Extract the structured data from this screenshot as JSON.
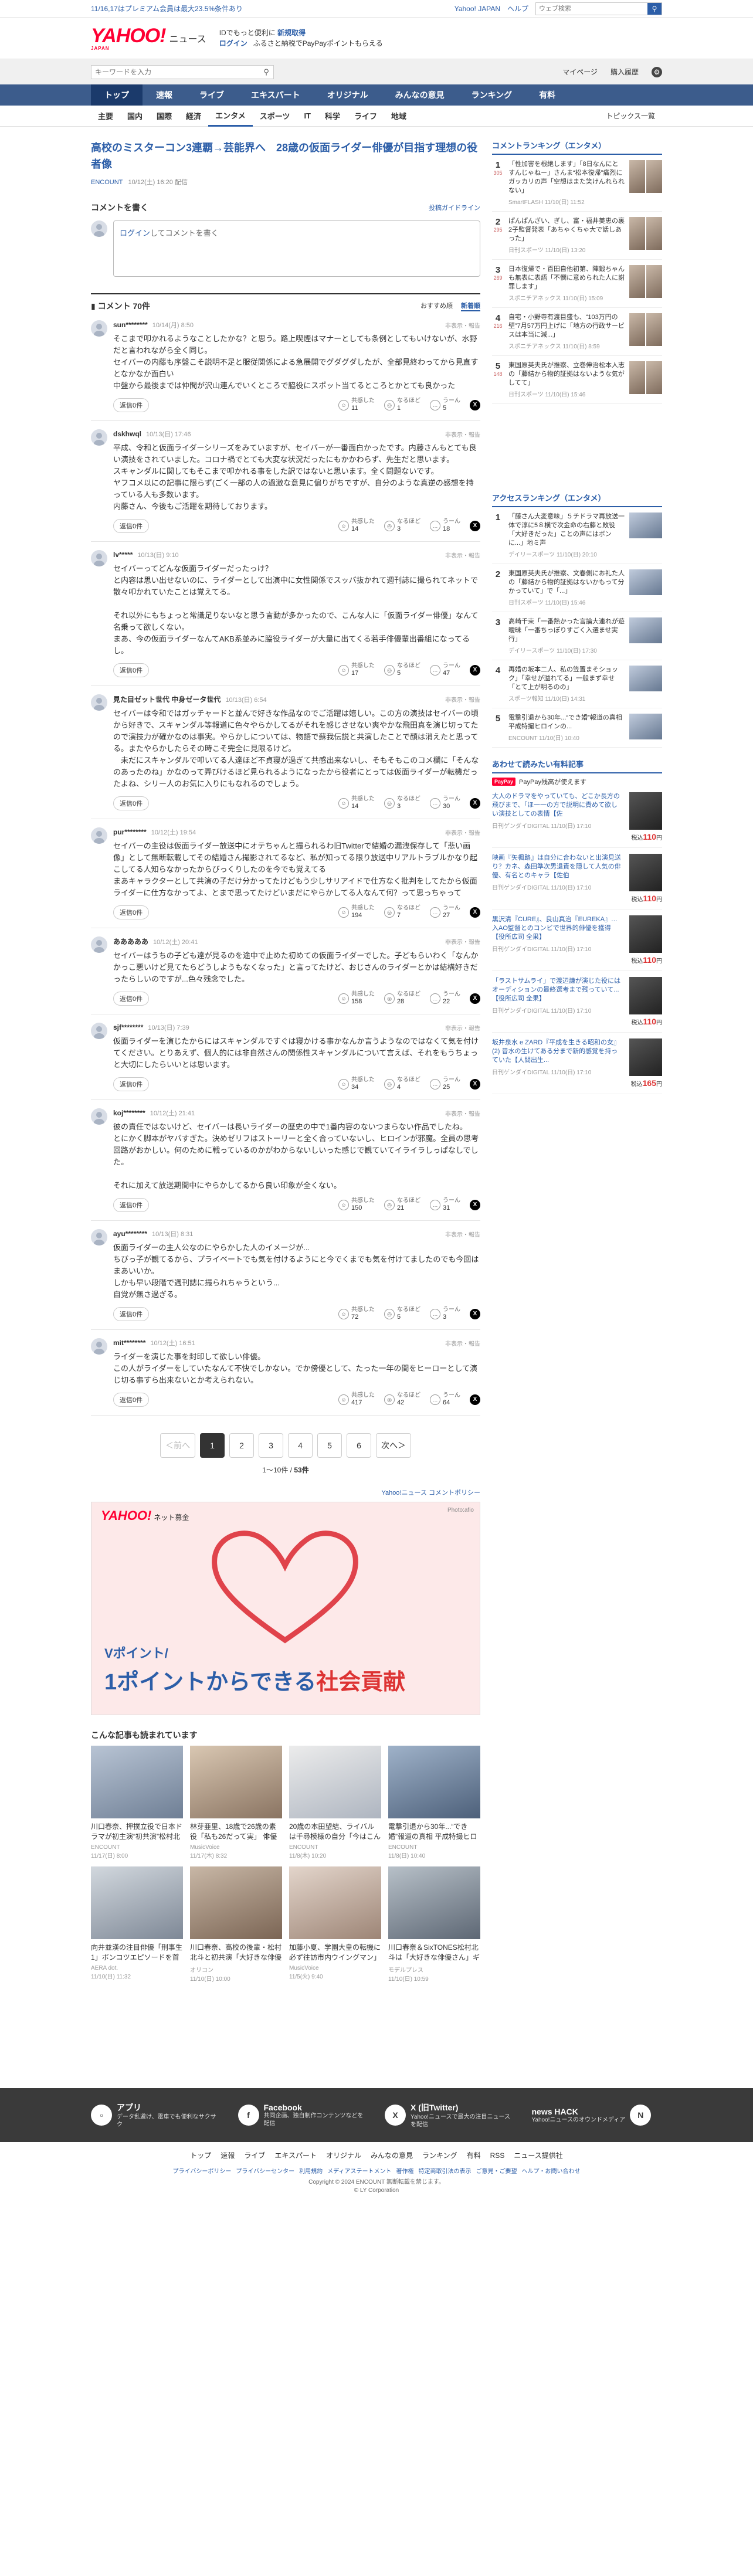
{
  "promo": {
    "text": "11/16,17はプレミアム会員は最大23.5%条件あり",
    "yj": "Yahoo! JAPAN",
    "help": "ヘルプ",
    "search_placeholder": "ウェブ検索"
  },
  "header": {
    "logo": "YAHOO!",
    "logo_sub": "JAPAN",
    "site": "ニュース",
    "msg1_a": "IDでもっと便利に",
    "msg1_b": "新規取得",
    "login": "ログイン",
    "msg2": "ふるさと納税でPayPayポイントもらえる"
  },
  "search": {
    "placeholder": "キーワードを入力",
    "mypage": "マイページ",
    "purchase": "購入履歴"
  },
  "mainnav": [
    "トップ",
    "速報",
    "ライブ",
    "エキスパート",
    "オリジナル",
    "みんなの意見",
    "ランキング",
    "有料"
  ],
  "subnav": {
    "items": [
      "主要",
      "国内",
      "国際",
      "経済",
      "エンタメ",
      "スポーツ",
      "IT",
      "科学",
      "ライフ",
      "地域"
    ],
    "topics": "トピックス一覧"
  },
  "article": {
    "title": "高校のミスターコン3連覇→芸能界へ　28歳の仮面ライダー俳優が目指す理想の役者像",
    "source": "ENCOUNT",
    "date": "10/12(土) 16:20 配信"
  },
  "comment_input": {
    "heading": "コメントを書く",
    "policy": "投稿ガイドライン",
    "login": "ログイン",
    "placeholder": "してコメントを書く"
  },
  "comments_header": {
    "title": "コメント 70件",
    "sort_rec": "おすすめ順",
    "sort_new": "新着順"
  },
  "comment_labels": {
    "reply": "返信0件",
    "report": "非表示・報告",
    "empathy": "共感した",
    "understand": "なるほど",
    "hmm": "うーん"
  },
  "comments": [
    {
      "user": "sun********",
      "time": "10/14(月) 8:50",
      "text": "そこまで叩かれるようなことしたかな？と思う。路上喫煙はマナーとしても条例としてもいけないが、水野だと言われながら全く同じ。\nセイバーの内藤も序盤こそ説明不足と服従関係による急展開でグダグダしたが、全部見終わってから見直すとなかなか面白い\n中盤から最後までは仲間が沢山連んでいくところで脇役にスポット当てるところとかとても良かった",
      "empathy": "11",
      "understand": "1",
      "hmm": "5"
    },
    {
      "user": "dskhwql",
      "time": "10/13(日) 17:46",
      "text": "平成、令和と仮面ライダーシリーズをみていますが、セイバーが一番面白かったです。内藤さんもとても良い演技をされていました。コロナ禍でとても大変な状況だったにもかかわらず、先生だと思います。\nスキャンダルに関してもそこまで叩かれる事をした訳ではないと思います。全く問題ないです。\nヤフコメ以にの記事に限らず(ごく一部の人の過激な意見に偏りがちですが、自分のような真逆の感想を持っている人も多数います。\n内藤さん、今後もご活躍を期待しております。",
      "empathy": "14",
      "understand": "3",
      "hmm": "18"
    },
    {
      "user": "lv*****",
      "time": "10/13(日) 9:10",
      "text": "セイバーってどんな仮面ライダーだったっけ？\nと内容は思い出せないのに、ライダーとして出演中に女性関係でスッパ抜かれて週刊誌に撮られてネットで散々叩かれていたことは覚えてる。\n\nそれ以外にもちょっと常識足りないなと思う言動が多かったので、こんな人に「仮面ライダー俳優」なんて名乗って欲しくない。\nまあ、今の仮面ライダーなんてAKB系並みに脇役ライダーが大量に出てくる若手俳優輩出番組になってるし。",
      "empathy": "17",
      "understand": "5",
      "hmm": "47"
    },
    {
      "user": "見た目ゼット世代 中身ゼータ世代",
      "time": "10/13(日) 6:54",
      "text": "セイバーは令和ではガッチャードと並んで好きな作品なのでご活躍は嬉しい。この方の演技はセイバーの頃から好きで、スキャンダル等報道に色々やらかしてるがそれを感じさせない爽やかな飛田真を演じ切ってたので演技力が確かなのは事実。やらかしについては、物語で蘇我伝説と共演したことで顔は消えたと思ってる。またやらかしたらその時こそ完全に見限るけど。\n　未だにスキャンダルで叩いてる人達ほど不貞寝が過ぎて共感出来ないし、そもそもこのコメ欄に「そんなのあったのね」かなのって弄びけるほど見られるようになったから役者にとっては仮面ライダーが転機だったよね、シリー人のお気に入りにもなれるのでしょう。",
      "empathy": "14",
      "understand": "3",
      "hmm": "30"
    },
    {
      "user": "pur********",
      "time": "10/12(土) 19:54",
      "text": "セイバーの主役は仮面ライダー放送中にオテちゃんと撮られるわ旧Twitterで結婚の漏洩保存して「悲い画像」として無断転載してその結婚さん撮影されてるなど、私が知ってる限り放送中リアルトラブルかなり起こしてる人知らなかったからびっくりしたのを今でも覚えてる\nまあキャラクターとして共演の子だけ分かってたけどもう少しサリアイドで仕方なく批判をしてたから仮面ライダーに仕方なかってよ、とまで思ってたけどいまだにやらかしてる人なんて何？って思っちゃって",
      "empathy": "194",
      "understand": "7",
      "hmm": "27"
    },
    {
      "user": "あああああ",
      "time": "10/12(土) 20:41",
      "text": "セイバーはうちの子ども達が見るのを途中で止めた初めての仮面ライダーでした。子どもらいわく「なんかかっこ悪いけど見てたらどうしようもなくなった」と言ってたけど、おじさんのライダーとかは結構好きだったらしいのですが...色々残念でした。",
      "empathy": "158",
      "understand": "28",
      "hmm": "22"
    },
    {
      "user": "sjf********",
      "time": "10/13(日) 7:39",
      "text": "仮面ライダーを演じたからにはスキャンダルですぐは寝かける事かなんか言うようなのではなくて気を付けてください。とりあえず、個人的には非自然さんの関係性スキャンダルについて言えば、それをもうちょっと大切にしたらいいとは思います。",
      "empathy": "34",
      "understand": "4",
      "hmm": "25"
    },
    {
      "user": "koj********",
      "time": "10/12(土) 21:41",
      "text": "彼の責任ではないけど、セイバーは長いライダーの歴史の中で1番内容のないつまらない作品でしたね。\nとにかく脚本がヤバすぎた。決めゼリフはストーリーと全く合っていないし、ヒロインが邪魔。全員の思考回路がおかしい。何のために戦っているのかがわからないしいった感じで観ていてイライラしっぱなしでした。\n\nそれに加えて放送期間中にやらかしてるから良い印象が全くない。",
      "empathy": "150",
      "understand": "21",
      "hmm": "31"
    },
    {
      "user": "ayu********",
      "time": "10/13(日) 8:31",
      "text": "仮面ライダーの主人公なのにやらかした人のイメージが...\nちびっ子が観てるから、プライベートでも気を付けるようにと今でくまでも気を付けてましたのでも今回はまあいいか。\nしかも早い段階で週刊誌に撮られちゃうという...\n自覚が無さ過ぎる。",
      "empathy": "72",
      "understand": "5",
      "hmm": "3"
    },
    {
      "user": "mit********",
      "time": "10/12(土) 16:51",
      "text": "ライダーを演じた事を封印して欲しい俳優。\nこの人がライダーをしていたなんて不快でしかない。でか傍優として、たった一年の間をヒーローとして演じ切る事すら出来ないとか考えられない。",
      "empathy": "417",
      "understand": "42",
      "hmm": "64"
    }
  ],
  "pager": {
    "prev": "＜前へ",
    "pages": [
      "1",
      "2",
      "3",
      "4",
      "5",
      "6"
    ],
    "next": "次へ＞",
    "count_a": "1〜10件",
    "count_b": "53件"
  },
  "ad": {
    "label": "Yahoo!ニュース コメントポリシー",
    "logo": "YAHOO!",
    "logo_sub": "ネット募金",
    "photo": "Photo:afio",
    "vp": "Vポイント/",
    "headline_a": "1ポイントからできる",
    "headline_b": "社会貢献"
  },
  "more": {
    "heading": "こんな記事も読まれています",
    "cards": [
      {
        "title": "川口春奈、押撲立役で日本ドラマが初主演“初共演”松村北斗と...",
        "src": "ENCOUNT",
        "time": "11/17(日) 8:00"
      },
      {
        "title": "林芽亜里、18歳で26歳の素役「私も26だって実」 俳優デビュー3...",
        "src": "MusicVoice",
        "time": "11/17(木) 8:32"
      },
      {
        "title": "20歳の本田望結、ライバルは千尋模様の自分「今はこんなことが...",
        "src": "ENCOUNT",
        "time": "11/8(木) 10:20"
      },
      {
        "title": "電撃引退から30年...“でき婚”報道の真相 平成特撮ヒロインの...",
        "src": "ENCOUNT",
        "time": "11/8(日) 10:40"
      },
      {
        "title": "向井並漢の注目俳優「刑事生1」ボンコツエピソードを首置ゲ...",
        "src": "AERA dot.",
        "time": "11/10(日) 11:32"
      },
      {
        "title": "川口春奈、高校の後輩・松村北斗と初共演「大好きな俳優さん...",
        "src": "オリコン",
        "time": "11/10(日) 10:00"
      },
      {
        "title": "加藤小夏、学園大皇の転機に必ず往訪市内ウイングマン」アオ...",
        "src": "MusicVoice",
        "time": "11/5(火) 9:40"
      },
      {
        "title": "川口春奈＆SixTONES松村北斗は「大好きな俳優さん」ギャップ...",
        "src": "モデルプレス",
        "time": "11/10(日) 10:59"
      }
    ]
  },
  "side_rank": {
    "heading": "コメントランキング（エンタメ）",
    "items": [
      {
        "rank": "1",
        "count": "305",
        "title": "「性加害を根絶します」「8日なんにとすんじゃねー」さんま“松本復帰”痛烈にガッカリの声「空想はまた笑けんれられない」",
        "src": "SmartFLASH 11/10(日) 11:52"
      },
      {
        "rank": "2",
        "count": "295",
        "title": "ぱんぱんざい、ぎし、富・福井美恵の裏2子監督発表「あちゃくちゃ大で話しあった」",
        "src": "日刊スポーツ 11/10(日) 13:20"
      },
      {
        "rank": "3",
        "count": "269",
        "title": "日本復帰で・百田自他初第、陣鍛ちゃんも無表に表語「不憫に意められた人に謝罪します」",
        "src": "スポニチアネックス 11/10(日) 15:09"
      },
      {
        "rank": "4",
        "count": "216",
        "title": "自宅・小野寺有渡目盛も、“103万円の壁”7月57万円上げに「地方の行政サービスは本当に減...」",
        "src": "スポニチアネックス 11/10(日) 8:59"
      },
      {
        "rank": "5",
        "count": "148",
        "title": "東国原英夫氏が推察、立巻伸治松本人志の「藤結から物的証拠はないような気がしてて」",
        "src": "日刊スポーツ 11/10(日) 15:46"
      }
    ]
  },
  "side_access": {
    "heading": "アクセスランキング（エンタメ）",
    "items": [
      {
        "rank": "1",
        "title": "「藤さん大変意味」５チドラマ再放送一体で淳に5８横で次金命の右藤と敗役「大好きだった」ことの声にはボンに...」地ミ声",
        "src": "デイリースポーツ 11/10(日) 20:10"
      },
      {
        "rank": "2",
        "title": "東国原英夫氏が推察、文春側にお礼た人の「藤結から物的証拠はないかもって分かっていて」で「...」",
        "src": "日刊スポーツ 11/10(日) 15:46"
      },
      {
        "rank": "3",
        "title": "高崎千束「一番熱かった言論大連れが遊曖昧「一番ちっぽりすごく入選ませ実行」",
        "src": "デイリースポーツ 11/10(日) 17:30"
      },
      {
        "rank": "4",
        "title": "再婚の坂本二人、私の笠置まそショック」「幸せが溢れてる」一般まず幸せ「とて上が明るのの」",
        "src": "スポーツ報知 11/10(日) 14:31"
      },
      {
        "rank": "5",
        "title": "電撃引退から30年...“でき婚”報道の真相 平成特撮ヒロインの...",
        "src": "ENCOUNT 11/10(日) 10:40"
      }
    ]
  },
  "side_mag": {
    "heading": "あわせて読みたい有料記事",
    "pp": "PayPay",
    "pp_text": "PayPay残高が使えます",
    "price_prefix": "税込",
    "items": [
      {
        "title": "大人のドラマをやっていても、どこか長方の飛びまで、「ほ一一の方で説明に責めて欲しい演技としての表情【佐",
        "src": "日刊ゲンダイDIGITAL 11/10(日) 17:10",
        "price": "110"
      },
      {
        "title": "映画『矢楓路』は自分に合わないと出演見送り？カネ、森田準次男退責を隠して人気の俳優、有名とのキャラ【佐伯",
        "src": "日刊ゲンダイDIGITAL 11/10(日) 17:10",
        "price": "110"
      },
      {
        "title": "黒沢清『CURE』、良山真治『EUREKA』…入AO監督とのコンビで世界的俳優を獲得【役所広司 全果】",
        "src": "日刊ゲンダイDIGITAL 11/10(日) 17:10",
        "price": "110"
      },
      {
        "title": "「ラストサムライ」で渡辺謙が演じた役にはオーディションの最終選考まで残っていて...【役所広司 全果】",
        "src": "日刊ゲンダイDIGITAL 11/10(日) 17:10",
        "price": "110"
      },
      {
        "title": "坂井泉水 e ZARD『平成を生きる昭和の女』(2) 昔水の生けてある分まで新的感覚を持っていた【人間出生...",
        "src": "日刊ゲンダイDIGITAL 11/10(日) 17:10",
        "price": "165"
      }
    ]
  },
  "footer": {
    "app_t": "アプリ",
    "app_s": "データ乱避け、電車でも便利なサクサク",
    "fb_t": "Facebook",
    "fb_s": "共同企画、独自制作コンテンツなどを配信",
    "x_t": "X (旧Twitter)",
    "x_s": "Yahoo!ニュースで最大の注目ニュースを配信",
    "nh_t": "news HACK",
    "nh_s": "Yahoo!ニュースのオウンドメディア",
    "links": [
      "トップ",
      "速報",
      "ライブ",
      "エキスパート",
      "オリジナル",
      "みんなの意見",
      "ランキング",
      "有料",
      "RSS",
      "ニュース提供社"
    ],
    "links2": [
      "プライバシーポリシー",
      "プライバシーセンター",
      "利用規約",
      "メディアステートメント",
      "著作権",
      "特定商取引法の表示",
      "ご意見・ご要望",
      "ヘルプ・お問い合わせ"
    ],
    "copy1": "Copyright © 2024 ENCOUNT 無断転載を禁じます。",
    "copy2": "© LY Corporation"
  }
}
